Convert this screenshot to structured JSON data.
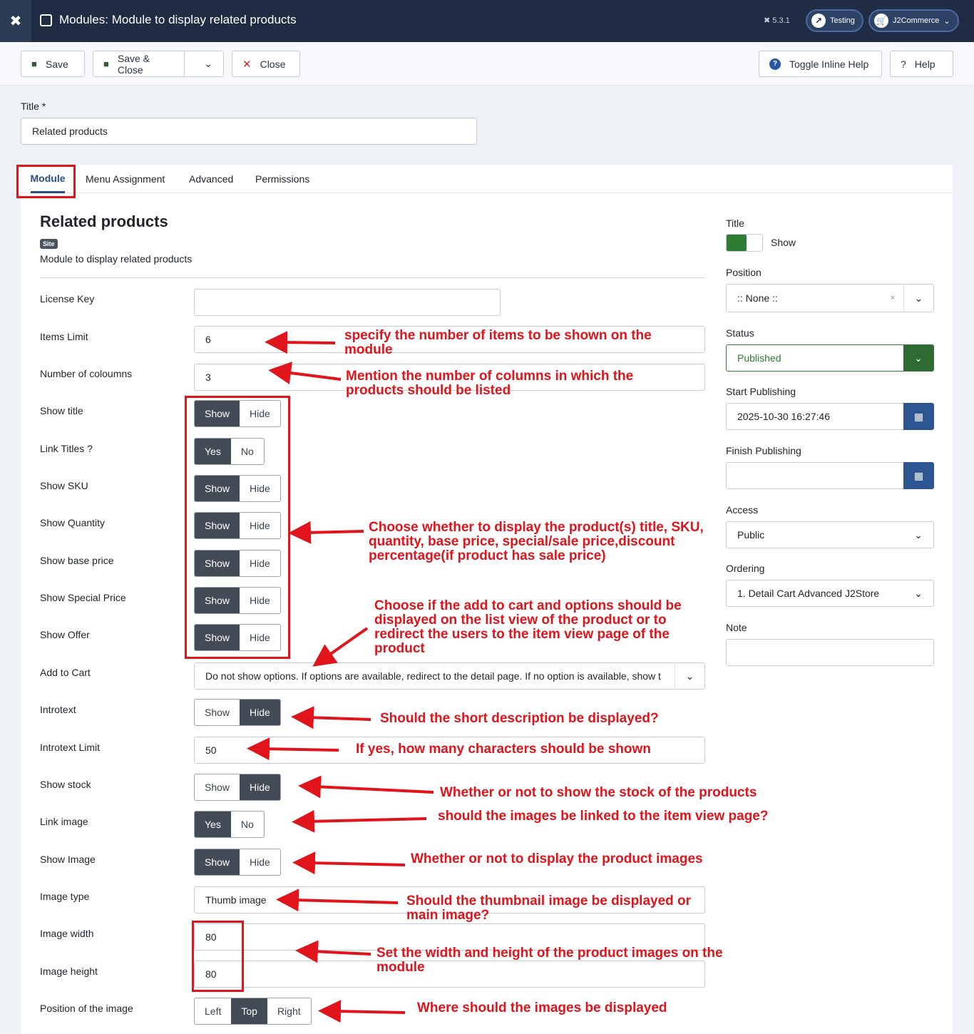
{
  "header": {
    "page_title": "Modules: Module to display related products",
    "version": "5.3.1",
    "site_link": "Testing",
    "user_menu": "J2Commerce"
  },
  "toolbar": {
    "save": "Save",
    "save_close": "Save & Close",
    "close": "Close",
    "toggle_help": "Toggle Inline Help",
    "help": "Help"
  },
  "title_field": {
    "label": "Title *",
    "value": "Related products"
  },
  "tabs": [
    "Module",
    "Menu Assignment",
    "Advanced",
    "Permissions"
  ],
  "module": {
    "heading": "Related products",
    "badge": "Site",
    "description": "Module to display related products"
  },
  "fields": {
    "license_key": {
      "label": "License Key",
      "value": ""
    },
    "items_limit": {
      "label": "Items Limit",
      "value": "6"
    },
    "columns": {
      "label": "Number of coloumns",
      "value": "3"
    },
    "show_title": {
      "label": "Show title",
      "options": [
        "Show",
        "Hide"
      ],
      "selected": "Show"
    },
    "link_titles": {
      "label": "Link Titles ?",
      "options": [
        "Yes",
        "No"
      ],
      "selected": "Yes"
    },
    "show_sku": {
      "label": "Show SKU",
      "options": [
        "Show",
        "Hide"
      ],
      "selected": "Show"
    },
    "show_quantity": {
      "label": "Show Quantity",
      "options": [
        "Show",
        "Hide"
      ],
      "selected": "Show"
    },
    "show_base_price": {
      "label": "Show base price",
      "options": [
        "Show",
        "Hide"
      ],
      "selected": "Show"
    },
    "show_special_price": {
      "label": "Show Special Price",
      "options": [
        "Show",
        "Hide"
      ],
      "selected": "Show"
    },
    "show_offer": {
      "label": "Show Offer",
      "options": [
        "Show",
        "Hide"
      ],
      "selected": "Show"
    },
    "add_to_cart": {
      "label": "Add to Cart",
      "value": "Do not show options. If options are available, redirect to the detail page. If no option is available, show t"
    },
    "introtext": {
      "label": "Introtext",
      "options": [
        "Show",
        "Hide"
      ],
      "selected": "Hide"
    },
    "introtext_limit": {
      "label": "Introtext Limit",
      "value": "50"
    },
    "show_stock": {
      "label": "Show stock",
      "options": [
        "Show",
        "Hide"
      ],
      "selected": "Hide"
    },
    "link_image": {
      "label": "Link image",
      "options": [
        "Yes",
        "No"
      ],
      "selected": "Yes"
    },
    "show_image": {
      "label": "Show Image",
      "options": [
        "Show",
        "Hide"
      ],
      "selected": "Show"
    },
    "image_type": {
      "label": "Image type",
      "value": "Thumb image"
    },
    "image_width": {
      "label": "Image width",
      "value": "80"
    },
    "image_height": {
      "label": "Image height",
      "value": "80"
    },
    "image_position": {
      "label": "Position of the image",
      "options": [
        "Left",
        "Top",
        "Right"
      ],
      "selected": "Top"
    }
  },
  "sidebar": {
    "title_label": "Title",
    "title_toggle": "Show",
    "position_label": "Position",
    "position_value": ":: None ::",
    "status_label": "Status",
    "status_value": "Published",
    "start_label": "Start Publishing",
    "start_value": "2025-10-30 16:27:46",
    "finish_label": "Finish Publishing",
    "finish_value": "",
    "access_label": "Access",
    "access_value": "Public",
    "ordering_label": "Ordering",
    "ordering_value": "1. Detail Cart Advanced J2Store",
    "note_label": "Note",
    "note_value": ""
  },
  "annotations": {
    "items": "specify the number of items to be shown on the module",
    "columns": "Mention the number of columns in which the products should be listed",
    "display": "Choose whether to display the product(s) title, SKU, quantity, base price, special/sale price,discount percentage(if product has sale price)",
    "cart": "Choose if the add to cart and options should be displayed on the list view of the product or to redirect the users to the item view page of the product",
    "intro": "Should the short description be displayed?",
    "intro_limit": "If yes, how many characters should be shown",
    "stock": "Whether or not to show the stock of the products",
    "link_image": "should the images be linked to the item view page?",
    "show_image": "Whether or not to display the product images",
    "image_type": "Should the thumbnail image be displayed or main image?",
    "size": "Set the width and height of the product images on the module",
    "position": "Where should the images be displayed"
  },
  "colors": {
    "header": "#1f2c44",
    "accent": "#2a4f80",
    "annotation": "#e0141a",
    "published": "#2e7d32",
    "active_segment": "#434b57"
  }
}
